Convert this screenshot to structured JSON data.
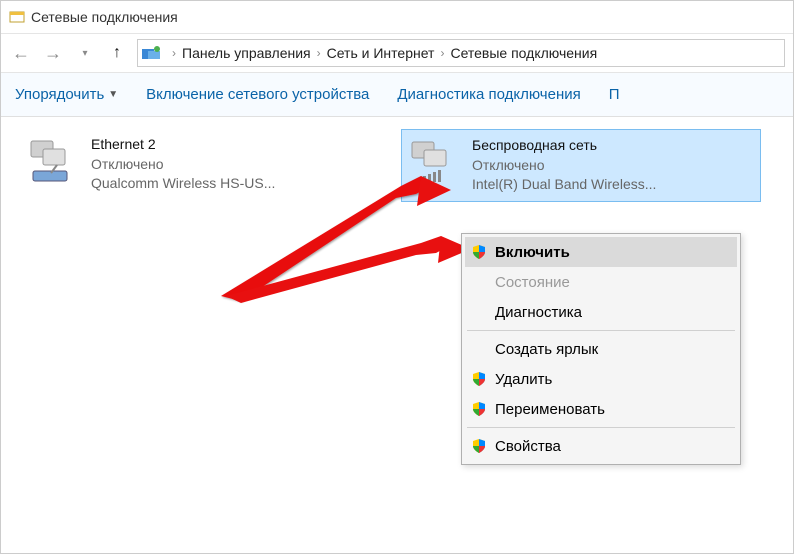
{
  "window": {
    "title": "Сетевые подключения"
  },
  "breadcrumb": {
    "seg1": "Панель управления",
    "seg2": "Сеть и Интернет",
    "seg3": "Сетевые подключения"
  },
  "toolbar": {
    "organize": "Упорядочить",
    "enable": "Включение сетевого устройства",
    "diagnose": "Диагностика подключения",
    "more": "П"
  },
  "adapters": [
    {
      "name": "Ethernet 2",
      "status": "Отключено",
      "device": "Qualcomm Wireless HS-US..."
    },
    {
      "name": "Беспроводная сеть",
      "status": "Отключено",
      "device": "Intel(R) Dual Band Wireless..."
    }
  ],
  "menu": {
    "enable": "Включить",
    "status": "Состояние",
    "diag": "Диагностика",
    "shortcut": "Создать ярлык",
    "delete": "Удалить",
    "rename": "Переименовать",
    "props": "Свойства"
  }
}
